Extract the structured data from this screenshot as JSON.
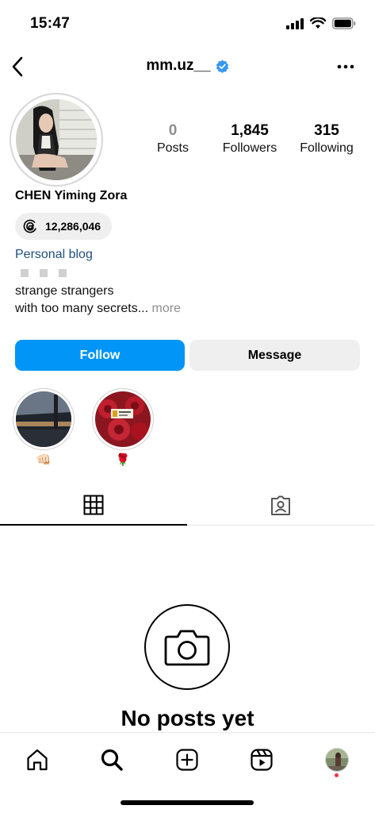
{
  "status_bar": {
    "time": "15:47"
  },
  "header": {
    "username": "mm.uz__",
    "verified_icon": "verified-badge-icon"
  },
  "profile": {
    "full_name": "CHEN Yiming Zora",
    "threads_count": "12,286,046",
    "link_text": "Personal blog",
    "bio_line1": "strange strangers",
    "bio_line2": "with too many secrets...",
    "bio_more": "more"
  },
  "stats": [
    {
      "value": "0",
      "label": "Posts"
    },
    {
      "value": "1,845",
      "label": "Followers"
    },
    {
      "value": "315",
      "label": "Following"
    }
  ],
  "buttons": {
    "follow": "Follow",
    "message": "Message"
  },
  "highlights": [
    {
      "label": "👊🏻"
    },
    {
      "label": "🌹"
    }
  ],
  "empty_state": {
    "title": "No posts yet"
  },
  "colors": {
    "accent": "#0095f6",
    "link": "#1e4e80",
    "verified": "#3897f0",
    "notification_dot": "#ff3040"
  }
}
